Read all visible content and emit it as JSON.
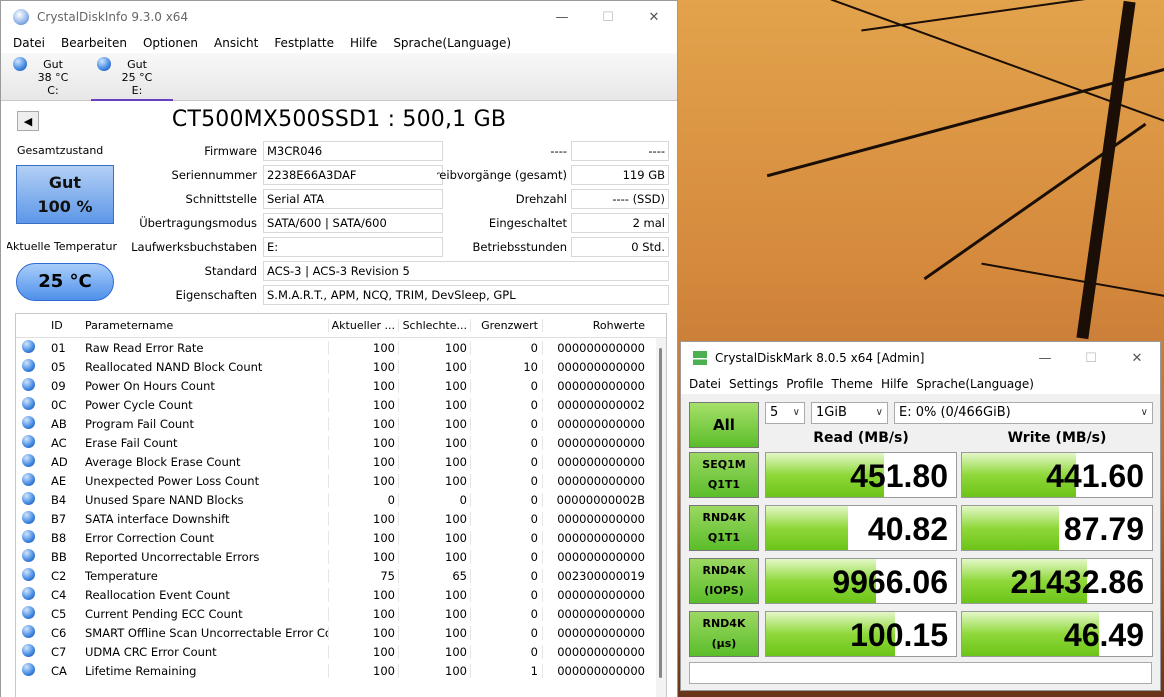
{
  "cdi": {
    "title": "CrystalDiskInfo 9.3.0 x64",
    "menu": [
      "Datei",
      "Bearbeiten",
      "Optionen",
      "Ansicht",
      "Festplatte",
      "Hilfe",
      "Sprache(Language)"
    ],
    "drives": [
      {
        "status": "Gut",
        "temp": "38 °C",
        "letter": "C:"
      },
      {
        "status": "Gut",
        "temp": "25 °C",
        "letter": "E:"
      }
    ],
    "model": "CT500MX500SSD1 : 500,1 GB",
    "health_label": "Gesamtzustand",
    "health_status": "Gut",
    "health_percent": "100 %",
    "temp_label": "Aktuelle Temperatur",
    "temp_value": "25 °C",
    "fields_left": [
      {
        "label": "Firmware",
        "value": "M3CR046"
      },
      {
        "label": "Seriennummer",
        "value": "2238E66A3DAF"
      },
      {
        "label": "Schnittstelle",
        "value": "Serial ATA"
      },
      {
        "label": "Übertragungsmodus",
        "value": "SATA/600 | SATA/600"
      },
      {
        "label": "Laufwerksbuchstaben",
        "value": "E:"
      }
    ],
    "fields_right": [
      {
        "label": "----",
        "value": "----"
      },
      {
        "label": "Schreibvorgänge (gesamt)",
        "value": "119 GB"
      },
      {
        "label": "Drehzahl",
        "value": "---- (SSD)"
      },
      {
        "label": "Eingeschaltet",
        "value": "2 mal"
      },
      {
        "label": "Betriebsstunden",
        "value": "0 Std."
      }
    ],
    "standard_label": "Standard",
    "standard_value": "ACS-3 | ACS-3 Revision 5",
    "features_label": "Eigenschaften",
    "features_value": "S.M.A.R.T., APM, NCQ, TRIM, DevSleep, GPL",
    "smart_headers": [
      "ID",
      "Parametername",
      "Aktueller ...",
      "Schlechte...",
      "Grenzwert",
      "Rohwerte"
    ],
    "smart_rows": [
      [
        "01",
        "Raw Read Error Rate",
        "100",
        "100",
        "0",
        "000000000000"
      ],
      [
        "05",
        "Reallocated NAND Block Count",
        "100",
        "100",
        "10",
        "000000000000"
      ],
      [
        "09",
        "Power On Hours Count",
        "100",
        "100",
        "0",
        "000000000000"
      ],
      [
        "0C",
        "Power Cycle Count",
        "100",
        "100",
        "0",
        "000000000002"
      ],
      [
        "AB",
        "Program Fail Count",
        "100",
        "100",
        "0",
        "000000000000"
      ],
      [
        "AC",
        "Erase Fail Count",
        "100",
        "100",
        "0",
        "000000000000"
      ],
      [
        "AD",
        "Average Block Erase Count",
        "100",
        "100",
        "0",
        "000000000000"
      ],
      [
        "AE",
        "Unexpected Power Loss Count",
        "100",
        "100",
        "0",
        "000000000000"
      ],
      [
        "B4",
        "Unused Spare NAND Blocks",
        "0",
        "0",
        "0",
        "00000000002B"
      ],
      [
        "B7",
        "SATA interface Downshift",
        "100",
        "100",
        "0",
        "000000000000"
      ],
      [
        "B8",
        "Error Correction Count",
        "100",
        "100",
        "0",
        "000000000000"
      ],
      [
        "BB",
        "Reported Uncorrectable Errors",
        "100",
        "100",
        "0",
        "000000000000"
      ],
      [
        "C2",
        "Temperature",
        "75",
        "65",
        "0",
        "002300000019"
      ],
      [
        "C4",
        "Reallocation Event Count",
        "100",
        "100",
        "0",
        "000000000000"
      ],
      [
        "C5",
        "Current Pending ECC Count",
        "100",
        "100",
        "0",
        "000000000000"
      ],
      [
        "C6",
        "SMART Offline Scan Uncorrectable Error Cou...",
        "100",
        "100",
        "0",
        "000000000000"
      ],
      [
        "C7",
        "UDMA CRC Error Count",
        "100",
        "100",
        "0",
        "000000000000"
      ],
      [
        "CA",
        "Lifetime Remaining",
        "100",
        "100",
        "1",
        "000000000000"
      ]
    ]
  },
  "cdm": {
    "title": "CrystalDiskMark 8.0.5 x64 [Admin]",
    "menu": [
      "Datei",
      "Settings",
      "Profile",
      "Theme",
      "Hilfe",
      "Sprache(Language)"
    ],
    "all_label": "All",
    "count": "5",
    "size": "1GiB",
    "drive": "E: 0% (0/466GiB)",
    "read_header": "Read (MB/s)",
    "write_header": "Write (MB/s)",
    "tests": [
      {
        "line1": "SEQ1M",
        "line2": "Q1T1",
        "read": "451.80",
        "write": "441.60",
        "read_fill": 0.62,
        "write_fill": 0.6
      },
      {
        "line1": "RND4K",
        "line2": "Q1T1",
        "read": "40.82",
        "write": "87.79",
        "read_fill": 0.43,
        "write_fill": 0.51
      },
      {
        "line1": "RND4K",
        "line2": "(IOPS)",
        "read": "9966.06",
        "write": "21432.86",
        "read_fill": 0.58,
        "write_fill": 0.66
      },
      {
        "line1": "RND4K",
        "line2": "(µs)",
        "read": "100.15",
        "write": "46.49",
        "read_fill": 0.68,
        "write_fill": 0.72
      }
    ]
  },
  "colors": {
    "accent": "#6a40c0",
    "good_blue": "#5d97e8",
    "cdm_green": "#6cc418"
  }
}
